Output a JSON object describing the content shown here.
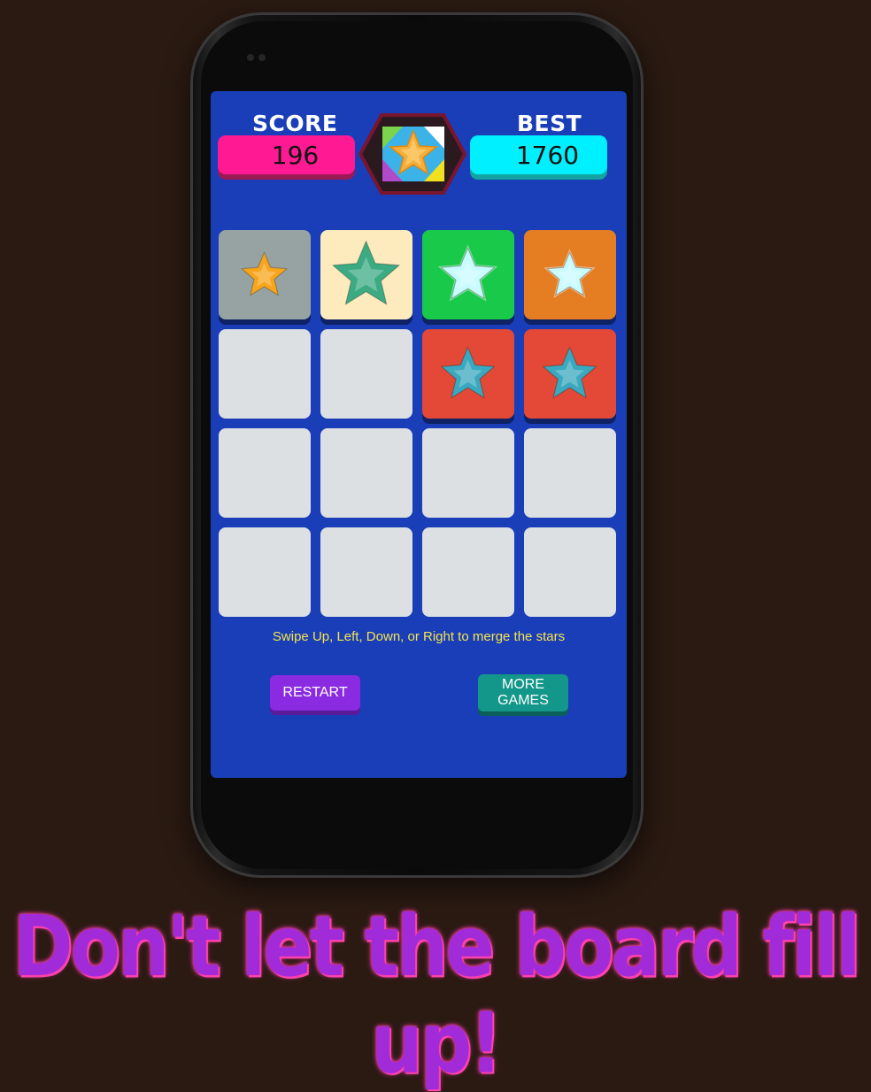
{
  "score": {
    "label": "SCORE",
    "value": "196"
  },
  "best": {
    "label": "BEST",
    "value": "1760"
  },
  "logo": {
    "icon": "star-hexagon-logo-icon"
  },
  "board": {
    "rows": [
      [
        {
          "state": "star",
          "bg": "#97a3a3",
          "star": "#f7a51b",
          "size": "small"
        },
        {
          "state": "star",
          "bg": "#fdebbd",
          "star": "#3cab84",
          "size": "large"
        },
        {
          "state": "star",
          "bg": "#19c94a",
          "star": "#c8fbff",
          "size": "medium",
          "glow": true
        },
        {
          "state": "star",
          "bg": "#e57d23",
          "star": "#c9fbff",
          "size": "small",
          "glow": true
        }
      ],
      [
        {
          "state": "empty"
        },
        {
          "state": "empty"
        },
        {
          "state": "star",
          "bg": "#e34936",
          "star": "#3aa8be",
          "size": "medium"
        },
        {
          "state": "star",
          "bg": "#e34936",
          "star": "#3aa8be",
          "size": "medium"
        }
      ],
      [
        {
          "state": "empty"
        },
        {
          "state": "empty"
        },
        {
          "state": "empty"
        },
        {
          "state": "empty"
        }
      ],
      [
        {
          "state": "empty"
        },
        {
          "state": "empty"
        },
        {
          "state": "empty"
        },
        {
          "state": "empty"
        }
      ]
    ]
  },
  "instructions": "Swipe Up, Left, Down, or Right to merge the stars",
  "buttons": {
    "restart": "RESTART",
    "more_games": "MORE\nGAMES"
  },
  "tagline": "Don't let the board fill up!"
}
